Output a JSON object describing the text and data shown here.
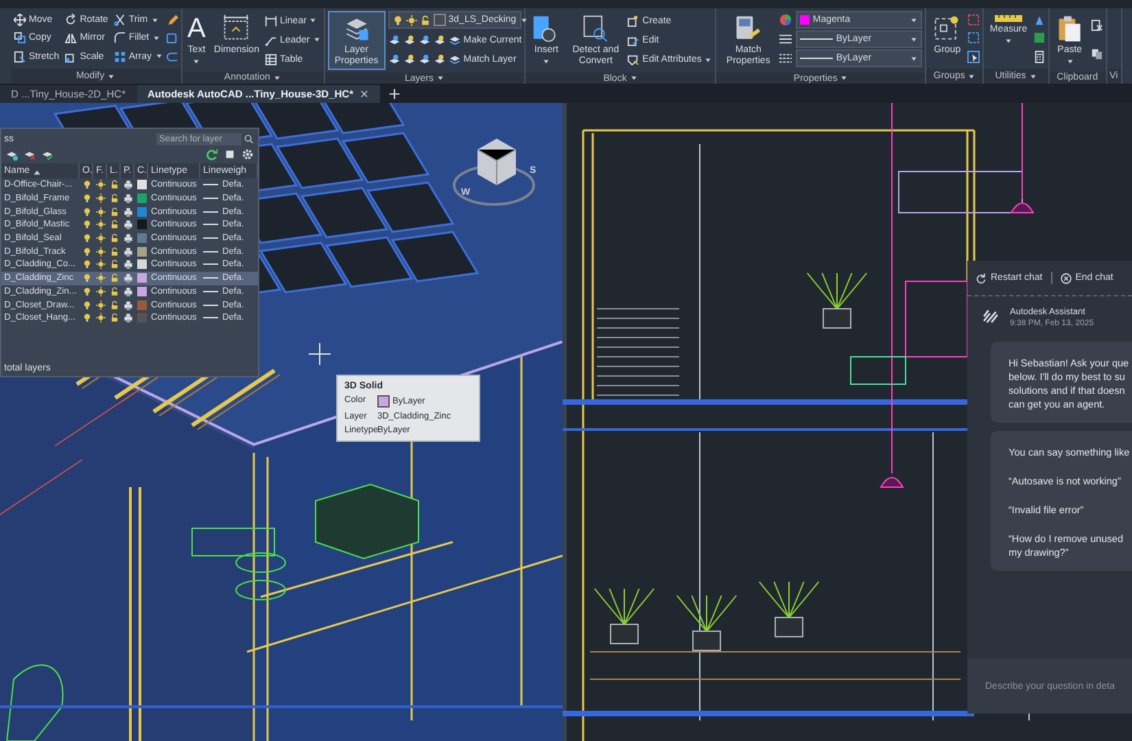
{
  "ribbon": {
    "panels": [
      {
        "title": "Modify",
        "menu": true,
        "small": [
          {
            "label": "Move",
            "menu": false
          },
          {
            "label": "Copy",
            "menu": false
          },
          {
            "label": "Stretch",
            "menu": false
          },
          {
            "label": "Rotate",
            "menu": false
          },
          {
            "label": "Mirror",
            "menu": false
          },
          {
            "label": "Scale",
            "menu": false
          },
          {
            "label": "Trim",
            "menu": true
          },
          {
            "label": "Fillet",
            "menu": true
          },
          {
            "label": "Array",
            "menu": true
          }
        ]
      },
      {
        "title": "Annotation",
        "menu": true,
        "large": [
          {
            "label": "Text",
            "glyph": "A",
            "menu": true,
            "selected": false
          },
          {
            "label": "Dimension",
            "menu": false,
            "selected": false
          }
        ],
        "small": [
          {
            "label": "Linear",
            "menu": true
          },
          {
            "label": "Leader",
            "menu": true
          },
          {
            "label": "Table",
            "menu": false
          }
        ]
      },
      {
        "title": "Layers",
        "menu": true,
        "large": [
          {
            "label": "Layer Properties",
            "menu": false,
            "selected": true
          }
        ],
        "dropdowns": [
          {
            "kind": "layer",
            "label": "3d_LS_Decking"
          }
        ],
        "small": [
          {
            "label": "Make Current",
            "menu": false
          },
          {
            "label": "Match Layer",
            "menu": false
          }
        ]
      },
      {
        "title": "Block",
        "menu": true,
        "large": [
          {
            "label": "Insert",
            "menu": true,
            "selected": false
          },
          {
            "label": "Detect and Convert",
            "menu": false,
            "selected": false
          }
        ],
        "small": [
          {
            "label": "Create",
            "menu": false
          },
          {
            "label": "Edit",
            "menu": false
          },
          {
            "label": "Edit Attributes",
            "menu": true
          }
        ]
      },
      {
        "title": "Properties",
        "menu": true,
        "large": [
          {
            "label": "Match Properties",
            "menu": false,
            "selected": false
          }
        ],
        "dropdowns": [
          {
            "kind": "color",
            "label": "Magenta",
            "color": "#ff00ff"
          },
          {
            "kind": "linetype",
            "label": "ByLayer"
          },
          {
            "kind": "lineweight",
            "label": "ByLayer"
          }
        ]
      },
      {
        "title": "Groups",
        "menu": true,
        "large": [
          {
            "label": "Group",
            "menu": false,
            "selected": false
          }
        ]
      },
      {
        "title": "Utilities",
        "menu": true,
        "large": [
          {
            "label": "Measure",
            "menu": true,
            "selected": false
          }
        ]
      },
      {
        "title": "Clipboard",
        "menu": false,
        "large": [
          {
            "label": "Paste",
            "menu": true,
            "selected": false
          }
        ]
      },
      {
        "title": "Vi",
        "menu": false
      }
    ]
  },
  "document_tabs": [
    {
      "label": "D ...Tiny_House-2D_HC*",
      "selected": false
    },
    {
      "label": "Autodesk AutoCAD ...Tiny_House-3D_HC*",
      "selected": true
    }
  ],
  "layer_manager": {
    "title": "ss",
    "search": {
      "placeholder": "Search for layer"
    },
    "columns": [
      "Name",
      "O.",
      "F.",
      "L.",
      "P.",
      "C.",
      "Linetype",
      "Lineweigh"
    ],
    "rows": [
      {
        "name": "D-Office-Chair-...",
        "color": "#e0e0e0",
        "linetype": "Continuous",
        "lineweight": "Defa.",
        "selected": false
      },
      {
        "name": "D_Bifold_Frame",
        "color": "#1aa36b",
        "linetype": "Continuous",
        "lineweight": "Defa.",
        "selected": false
      },
      {
        "name": "D_Bifold_Glass",
        "color": "#1e88d8",
        "linetype": "Continuous",
        "lineweight": "Defa.",
        "selected": false
      },
      {
        "name": "D_Bifold_Mastic",
        "color": "#15181c",
        "linetype": "Continuous",
        "lineweight": "Defa.",
        "selected": false
      },
      {
        "name": "D_Bifold_Seal",
        "color": "#5f7a8f",
        "linetype": "Continuous",
        "lineweight": "Defa.",
        "selected": false
      },
      {
        "name": "D_Bifold_Track",
        "color": "#a8a08a",
        "linetype": "Continuous",
        "lineweight": "Defa.",
        "selected": false
      },
      {
        "name": "D_Cladding_Co...",
        "color": "#d8d8d8",
        "linetype": "Continuous",
        "lineweight": "Defa.",
        "selected": false
      },
      {
        "name": "D_Cladding_Zinc",
        "color": "#c9a6e0",
        "linetype": "Continuous",
        "lineweight": "Defa.",
        "selected": true
      },
      {
        "name": "D_Cladding_Zin...",
        "color": "#c9a6e0",
        "linetype": "Continuous",
        "lineweight": "Defa.",
        "selected": false
      },
      {
        "name": "D_Closet_Draw...",
        "color": "#9a5a3a",
        "linetype": "Continuous",
        "lineweight": "Defa.",
        "selected": false
      },
      {
        "name": "D_Closet_Hang...",
        "color": "#555555",
        "linetype": "Continuous",
        "lineweight": "Defa.",
        "selected": false
      }
    ],
    "footer": "total layers"
  },
  "viewcube": {
    "compass": [
      "W",
      "S"
    ]
  },
  "tooltip": {
    "title": "3D Solid",
    "fields": [
      {
        "label": "Color",
        "value": "ByLayer",
        "color": "#c9a6e0"
      },
      {
        "label": "Layer",
        "value": "3D_Cladding_Zinc"
      },
      {
        "label": "Linetype",
        "value": "ByLayer"
      }
    ]
  },
  "chat": {
    "restart": "Restart chat",
    "end": "End chat",
    "sender": "Autodesk Assistant",
    "time": "9:38 PM, Feb 13, 2025",
    "messages": [
      [
        "Hi Sebastian! Ask your que\nbelow. I'll do my best to su\nsolutions and if that doesn\ncan get you an agent."
      ],
      [
        "You can say something like",
        "“Autosave is not working”",
        "“Invalid file error”",
        "“How do I remove unused\nmy drawing?”"
      ]
    ],
    "input": {
      "placeholder": "Describe your question in deta"
    }
  }
}
